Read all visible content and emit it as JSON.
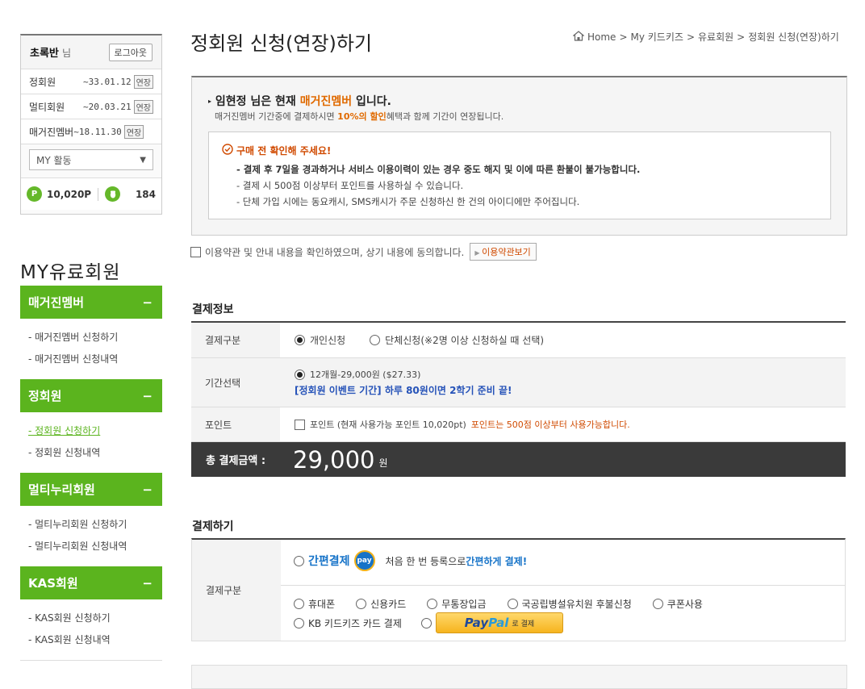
{
  "user": {
    "name": "초록반",
    "suffix": "님",
    "logout_label": "로그아웃",
    "memberships": [
      {
        "label": "정회원",
        "date": "~33.01.12",
        "tag": "연장"
      },
      {
        "label": "멀티회원",
        "date": "~20.03.21",
        "tag": "연장"
      },
      {
        "label": "매거진멤버",
        "date": "~18.11.30",
        "tag": "연장"
      }
    ],
    "activity_select": "MY 활동",
    "points": "10,020P",
    "count": "184",
    "points_icon": "P"
  },
  "sidebar": {
    "title": "MY유료회원",
    "groups": [
      {
        "label": "매거진멤버",
        "toggle": "−",
        "items": [
          "- 매거진멤버 신청하기",
          "- 매거진멤버 신청내역"
        ]
      },
      {
        "label": "정회원",
        "toggle": "−",
        "items": [
          "- 정회원 신청하기",
          "- 정회원 신청내역"
        ]
      },
      {
        "label": "멀티누리회원",
        "toggle": "−",
        "items": [
          "- 멀티누리회원 신청하기",
          "- 멀티누리회원 신청내역"
        ]
      },
      {
        "label": "KAS회원",
        "toggle": "−",
        "items": [
          "- KAS회원 신청하기",
          "- KAS회원 신청내역"
        ]
      }
    ]
  },
  "page": {
    "title": "정회원 신청(연장)하기",
    "breadcrumb": [
      "Home",
      ">",
      "My 키드키즈",
      ">",
      "유료회원",
      ">",
      "정회원 신청(연장)하기"
    ]
  },
  "notice": {
    "line1_pre": "임현정 님은 현재 ",
    "line1_hl": "매거진멤버",
    "line1_post": " 입니다.",
    "line2_pre": "매거진멤버 기간중에 결제하시면 ",
    "line2_hl": "10%의 할인",
    "line2_post": "혜택과 함께 기간이 연장됩니다.",
    "warn_title": "구매 전 확인해 주세요!",
    "warn_items": [
      "- 결제 후 7일을 경과하거나 서비스 이용이력이 있는 경우 중도 해지 및 이에 따른 환불이 불가능합니다.",
      "- 결제 시 500점 이상부터 포인트를 사용하실 수 있습니다.",
      "- 단체 가입 시에는 동요캐시, SMS캐시가 주문 신청하신 한 건의 아이디에만 주어집니다."
    ]
  },
  "agree": {
    "text": "이용약관 및 안내 내용을 확인하였으며, 상기 내용에 동의합니다.",
    "button": "이용약관보기"
  },
  "payment_info": {
    "heading": "결제정보",
    "type_label": "결제구분",
    "type_options": [
      "개인신청",
      "단체신청(※2명 이상 신청하실 때 선택)"
    ],
    "period_label": "기간선택",
    "period_option": "12개월-29,000원 ($27.33)",
    "period_event": "[정회원 이벤트 기간] 하루 80원이면 2학기 준비 끝!",
    "points_label": "포인트",
    "points_text": "포인트 (현재 사용가능 포인트 10,020pt)",
    "points_note": "포인트는 500점 이상부터 사용가능합니다.",
    "total_label": "총 결제금액 :",
    "total_amount": "29,000",
    "total_unit": "원"
  },
  "pay": {
    "heading": "결제하기",
    "type_label": "결제구분",
    "easy_label": "간편결제",
    "easy_logo": "pay",
    "easy_desc_pre": "처음 한 번 등록으로 ",
    "easy_desc_hl": "간편하게 결제!",
    "methods": [
      "휴대폰",
      "신용카드",
      "무통장입금",
      "국공립병설유치원 후불신청",
      "쿠폰사용"
    ],
    "kb_label": "KB 키드키즈 카드 결제",
    "paypal_logo_a": "Pay",
    "paypal_logo_b": "Pal",
    "paypal_suffix": "로 결제"
  }
}
